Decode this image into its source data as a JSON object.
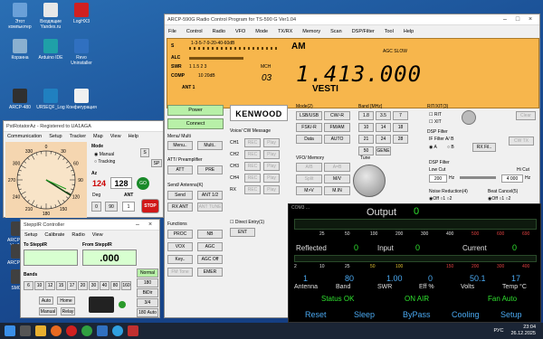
{
  "desktop": {
    "icons": [
      {
        "label": "Этот компьютер",
        "color": "#6aa0d8"
      },
      {
        "label": "Входящие Yandex.ru",
        "color": "#e8e8e8"
      },
      {
        "label": "LogHX3",
        "color": "#d02020"
      },
      {
        "label": "Корзина",
        "color": "#8ab0d0"
      },
      {
        "label": "Arduino IDE",
        "color": "#1fa0a8"
      },
      {
        "label": "Revo Uninstaller",
        "color": "#3070c0"
      },
      {
        "label": "ARCP-480",
        "color": "#303030"
      },
      {
        "label": "UR5EQF_Log",
        "color": "#2080c0"
      },
      {
        "label": "Конфигурация",
        "color": "#f0f0f0"
      },
      {
        "label": "ARCP-590 Ver1.04",
        "color": "#404040"
      },
      {
        "label": "ARCP-590",
        "color": "#404040"
      },
      {
        "label": "SMC...",
        "color": "#404040"
      }
    ]
  },
  "rotator": {
    "title": "PstRotatorAz - Registered to UA1AGA",
    "menu": [
      "Communication",
      "Setup",
      "Tracker",
      "Map",
      "View",
      "Help"
    ],
    "compass_labels": [
      "0",
      "30",
      "60",
      "90",
      "120",
      "150",
      "180",
      "210",
      "240",
      "270",
      "300",
      "330"
    ],
    "mode_label": "Mode",
    "manual": "Manual",
    "tracking": "Tracking",
    "stop_btn": "S",
    "sp_btn": "SP",
    "az_label": "Az",
    "az_current": "124",
    "az_target": "128",
    "go_btn": "GO",
    "deg_label": "Deg",
    "ant_label": "ANT",
    "ant_value": "1",
    "stop_big": "STOP",
    "deg_0": "0",
    "deg_90": "90",
    "deg_1": "1"
  },
  "stepp": {
    "title": "SteppIR Controller",
    "menu": [
      "Setup",
      "Calibrate",
      "Radio",
      "View"
    ],
    "to_label": "To SteppIR",
    "from_label": "From SteppIR",
    "from_value": ".000",
    "bands_label": "Bands",
    "bands": [
      "6",
      "10",
      "12",
      "15",
      "17",
      "20",
      "30",
      "40",
      "80",
      "160"
    ],
    "side_btns": [
      "Normal",
      "180",
      "BiDir",
      "3/4",
      "180 Auto"
    ],
    "auto": "Auto",
    "home": "Home",
    "manual": "Manual",
    "relay": "Relay"
  },
  "arcp": {
    "title": "ARCP-590G Radio Control Program for TS-590 G Ver1.04",
    "menu": [
      "File",
      "Control",
      "Radio",
      "VFO",
      "Mode",
      "TX/RX",
      "Memory",
      "Scan",
      "DSP/Filter",
      "Tool",
      "Help"
    ],
    "lcd": {
      "s_label": "S",
      "s_scale": "1-3-5-7-9-20-40-60dB",
      "alc": "ALC",
      "swr": "SWR",
      "comp": "COMP",
      "swr_vals": "1 1.5 2 3",
      "comp_vals": "10 20dB",
      "mode": "AM",
      "agc": "AGC SLOW",
      "mch_label": "MCH",
      "mch_value": "03",
      "freq": "1.413.000",
      "ant": "ANT 1",
      "name": "VESTI"
    },
    "power": "Power",
    "connect": "Connect",
    "kenwood": "KENWOOD",
    "menu_multi_label": "Menu/ Multi",
    "menu_btn": "Menu..",
    "multi_btn": "Multi..",
    "att_label": "ATT/ Preamplifier",
    "att": "ATT",
    "pre": "PRE",
    "send_label": "Send/ Antenna(K)",
    "send": "Send",
    "ant12": "ANT 1/2",
    "rxant": "RX ANT",
    "ant_tune": "ANT TUNE",
    "func_label": "Functions",
    "proc": "PROC",
    "nb": "NB",
    "vox": "VOX",
    "agc": "AGC",
    "key": "Key..",
    "agcoff": "AGC Off",
    "fmtone": "FM Tone",
    "emer": "EMER",
    "voice_label": "Voice/ CW Message",
    "ch_labels": [
      "CH1",
      "CH2",
      "CH3",
      "CH4",
      "RX"
    ],
    "rec": "REC",
    "play": "Play",
    "direct": "Direct Entry(1)",
    "ent": "ENT",
    "mode_label": "Mode(2)",
    "modes": [
      "LSB/USB",
      "CW/-R",
      "FSK/-R",
      "FM/AM",
      "Data",
      "AUTO"
    ],
    "vfo_label": "VFO/ Memory",
    "vfo_btns": [
      "A/B",
      "A=B",
      "Split",
      "M/V",
      "M>V",
      "M.IN"
    ],
    "tune_label": "Tune",
    "band_label": "Band [MHz]",
    "bands": [
      "1.8",
      "3.5",
      "7",
      "10",
      "14",
      "18",
      "21",
      "24",
      "28",
      "50",
      "GENE"
    ],
    "rit_label": "RIT/XIT(3)",
    "rit": "RIT",
    "xit": "XIT",
    "clear": "Clear",
    "dsp_label": "DSP Filter",
    "if_label": "IF Filter A/ B",
    "a_label": "A",
    "b_label": "B",
    "rx_fil": "RX Fil..",
    "cw_tx": "CW TX",
    "dsp2_label": "DSP Filter",
    "low_cut": "Low Cut",
    "low_val": "200",
    "hi_cut": "Hi Cut",
    "hi_val": "4 000",
    "hz": "Hz",
    "nr_label": "Noise Reduction(4)",
    "beat_label": "Beat Cancel(5)",
    "off": "Off",
    "one": "1",
    "two": "2"
  },
  "amp": {
    "title": "COM3 ...",
    "output_label": "Output",
    "output_value": "0",
    "scale_top": [
      "",
      "25",
      "50",
      "100",
      "200",
      "300",
      "400",
      "500",
      "600",
      "690"
    ],
    "reflected_label": "Reflected",
    "reflected_value": "0",
    "input_label": "Input",
    "input_value": "0",
    "current_label": "Current",
    "current_value": "0",
    "scale_bot": [
      "2",
      "10",
      "25",
      "50",
      "100",
      "",
      "150",
      "200",
      "300",
      "400"
    ],
    "stats": [
      {
        "value": "1",
        "label": "Antenna"
      },
      {
        "value": "80",
        "label": "Band"
      },
      {
        "value": "1.00",
        "label": "SWR"
      },
      {
        "value": "0",
        "label": "Eff %"
      },
      {
        "value": "50.1",
        "label": "Volts"
      },
      {
        "value": "17",
        "label": "Temp °C"
      }
    ],
    "status": [
      "Status OK",
      "ON AIR",
      "Fan Auto"
    ],
    "buttons": [
      "Reset",
      "Sleep",
      "ByPass",
      "Cooling",
      "Setup"
    ]
  },
  "taskbar": {
    "lang": "РУС",
    "time": "23:04",
    "date": "26.12.2025"
  }
}
